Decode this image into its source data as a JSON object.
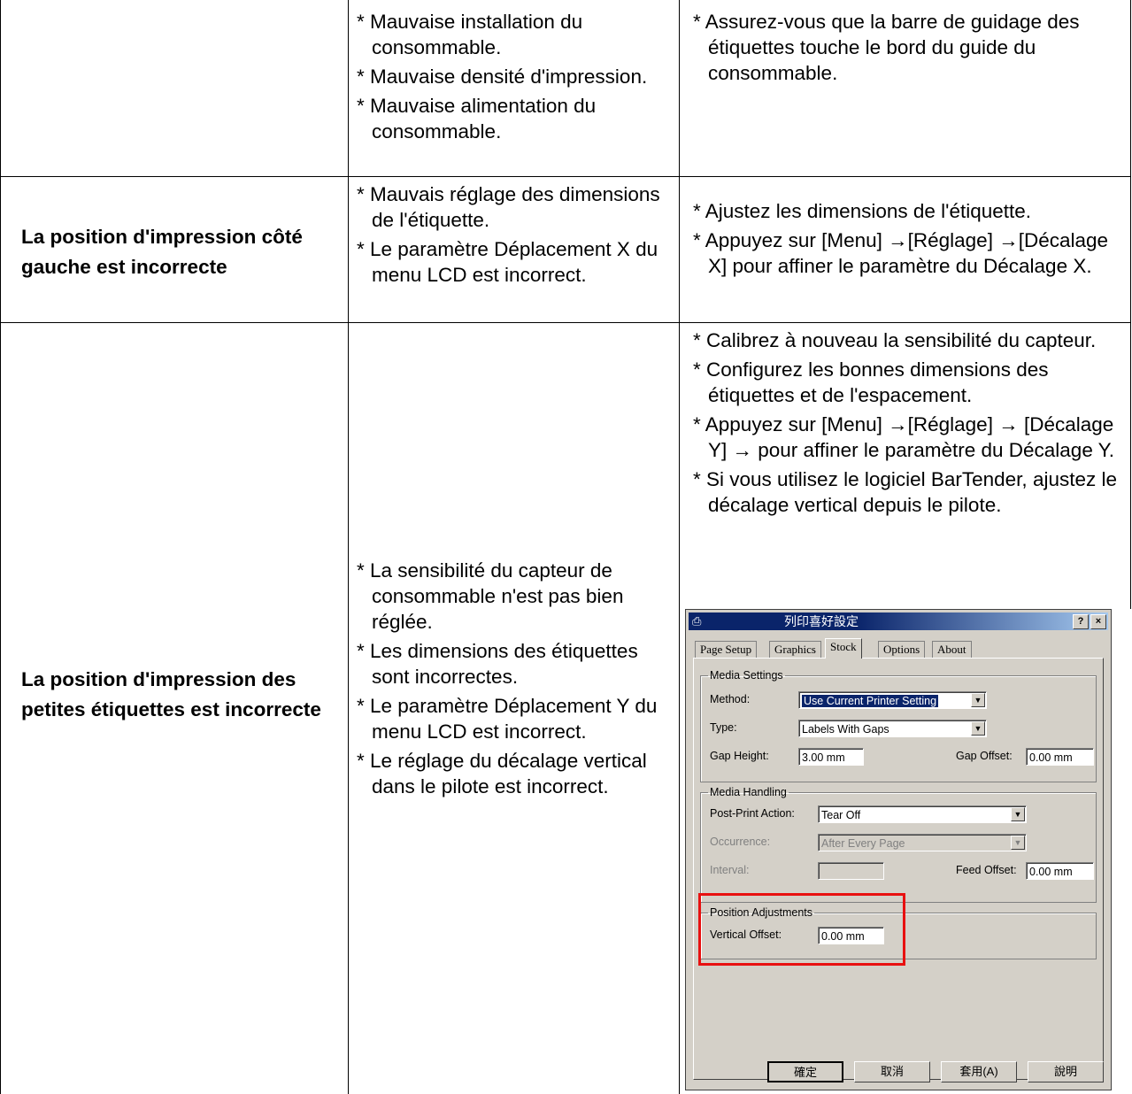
{
  "rows": [
    {
      "problem": "",
      "causes": [
        "* Mauvaise installation du consommable.",
        "* Mauvaise densité d'impression.",
        "* Mauvaise alimentation du consommable."
      ],
      "solutions": [
        "* Assurez-vous que la barre de guidage des étiquettes touche le bord du guide du consommable."
      ]
    },
    {
      "problem": "La position d'impression côté gauche est incorrecte",
      "causes": [
        "* Mauvais réglage des dimensions de l'étiquette.",
        "* Le paramètre Déplacement X du menu LCD est incorrect."
      ],
      "solutions": [
        "* Ajustez les dimensions de l'étiquette.",
        "* Appuyez sur [Menu] →[Réglage] →[Décalage X] pour affiner le paramètre du Décalage X."
      ]
    },
    {
      "problem": "La position d'impression des petites étiquettes est incorrecte",
      "causes": [
        "* La sensibilité du capteur de consommable n'est pas bien réglée.",
        "* Les dimensions des étiquettes sont incorrectes.",
        "* Le paramètre Déplacement Y du menu LCD est incorrect.",
        "* Le réglage du décalage vertical dans le pilote est incorrect."
      ],
      "solutions": [
        "* Calibrez à nouveau la sensibilité du capteur.",
        "* Configurez les bonnes dimensions des étiquettes et de l'espacement.",
        "* Appuyez sur [Menu] →[Réglage] → [Décalage Y] → pour affiner le paramètre du Décalage Y.",
        "* Si vous utilisez le logiciel BarTender, ajustez le décalage vertical depuis le pilote."
      ]
    }
  ],
  "dialog": {
    "title": "列印喜好設定",
    "help_btn": "?",
    "close_btn": "×",
    "app_icon": "printer-icon",
    "tabs": [
      "Page Setup",
      "Graphics",
      "Stock",
      "Options",
      "About"
    ],
    "active_tab": "Stock",
    "media_settings": {
      "legend": "Media Settings",
      "method_label": "Method:",
      "method_value": "Use Current Printer Setting",
      "type_label": "Type:",
      "type_value": "Labels With Gaps",
      "gap_height_label": "Gap Height:",
      "gap_height_value": "3.00 mm",
      "gap_offset_label": "Gap Offset:",
      "gap_offset_value": "0.00 mm"
    },
    "media_handling": {
      "legend": "Media Handling",
      "post_print_label": "Post-Print Action:",
      "post_print_value": "Tear Off",
      "occurrence_label": "Occurrence:",
      "occurrence_value": "After Every Page",
      "interval_label": "Interval:",
      "interval_value": "",
      "feed_offset_label": "Feed Offset:",
      "feed_offset_value": "0.00 mm"
    },
    "position_adjustments": {
      "legend": "Position Adjustments",
      "vertical_offset_label": "Vertical Offset:",
      "vertical_offset_value": "0.00 mm"
    },
    "buttons": {
      "ok": "確定",
      "cancel": "取消",
      "apply": "套用(A)",
      "help": "說明"
    },
    "highlight_color": "#e81010"
  }
}
